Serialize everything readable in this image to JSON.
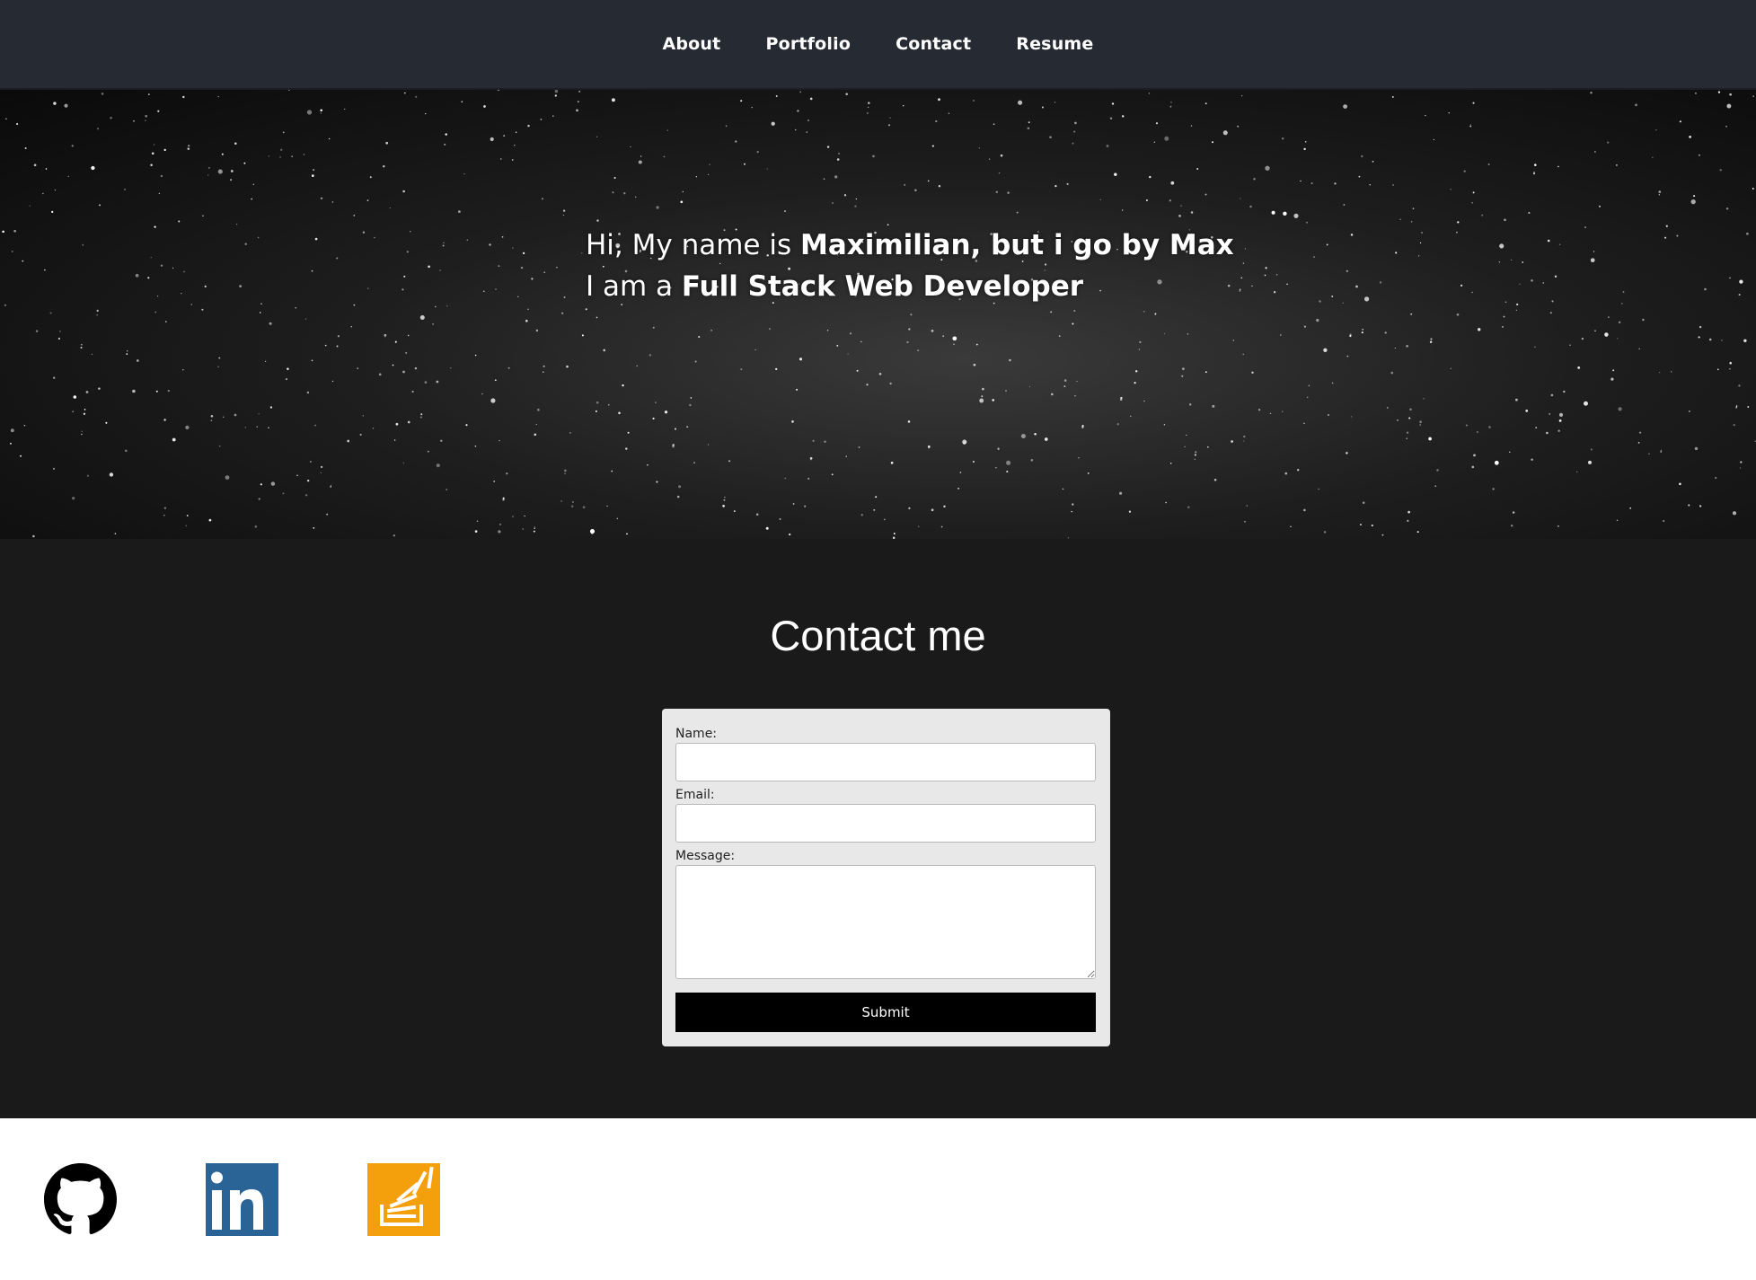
{
  "nav": {
    "items": [
      {
        "label": "About"
      },
      {
        "label": "Portfolio"
      },
      {
        "label": "Contact"
      },
      {
        "label": "Resume"
      }
    ]
  },
  "hero": {
    "line1_prefix": "Hi, My name is ",
    "line1_bold": "Maximilian, but i go by Max",
    "line2_prefix": "I am a ",
    "line2_bold": "Full Stack Web Developer"
  },
  "contact": {
    "title": "Contact me",
    "name_label": "Name:",
    "name_value": "",
    "email_label": "Email:",
    "email_value": "",
    "message_label": "Message:",
    "message_value": "",
    "submit_label": "Submit"
  },
  "footer": {
    "social": [
      {
        "icon": "github-icon"
      },
      {
        "icon": "linkedin-icon",
        "color": "#2a6396"
      },
      {
        "icon": "stackoverflow-icon",
        "color": "#f4a00c"
      }
    ]
  },
  "colors": {
    "nav_bg": "#262a33",
    "contact_bg": "#1a1a1a",
    "form_bg": "#e8e8e8",
    "button_bg": "#000000"
  }
}
